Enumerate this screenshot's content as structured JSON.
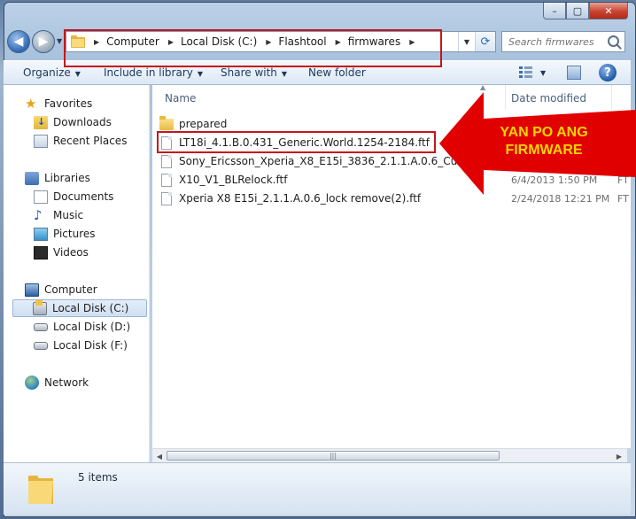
{
  "window": {
    "caption_buttons": [
      "–",
      "▢",
      "✕"
    ]
  },
  "address_bar": {
    "crumbs": [
      "Computer",
      "Local Disk (C:)",
      "Flashtool",
      "firmwares"
    ]
  },
  "search": {
    "placeholder": "Search firmwares"
  },
  "toolbar": {
    "organize": "Organize",
    "include_in_library": "Include in library",
    "share_with": "Share with",
    "new_folder": "New folder"
  },
  "nav_pane": {
    "favorites": {
      "label": "Favorites",
      "items": [
        "Downloads",
        "Recent Places"
      ]
    },
    "libraries": {
      "label": "Libraries",
      "items": [
        "Documents",
        "Music",
        "Pictures",
        "Videos"
      ]
    },
    "computer": {
      "label": "Computer",
      "items": [
        "Local Disk (C:)",
        "Local Disk (D:)",
        "Local Disk (F:)"
      ],
      "selected": "Local Disk (C:)"
    },
    "network": {
      "label": "Network"
    }
  },
  "file_list": {
    "columns": {
      "name": "Name",
      "date_modified": "Date modified"
    },
    "rows": [
      {
        "name": "prepared",
        "date": "",
        "type": "",
        "kind": "folder"
      },
      {
        "name": "LT18i_4.1.B.0.431_Generic.World.1254-2184.ftf",
        "date": "",
        "type": "FT",
        "kind": "file"
      },
      {
        "name": "Sony_Ericsson_Xperia_X8_E15i_3836_2.1.1.A.0.6_Customized_",
        "date": "",
        "type": "FT",
        "kind": "file"
      },
      {
        "name": "X10_V1_BLRelock.ftf",
        "date": "6/4/2013 1:50 PM",
        "type": "FT",
        "kind": "file"
      },
      {
        "name": "Xperia X8  E15i_2.1.1.A.0.6_lock remove(2).ftf",
        "date": "2/24/2018 12:21 PM",
        "type": "FT",
        "kind": "file"
      }
    ]
  },
  "details_pane": {
    "count": "5 items"
  },
  "annotation": {
    "line1": "YAN PO ANG",
    "line2": "FIRMWARE",
    "box_color": "#c4161c",
    "arrow_color": "#e00000",
    "text_color": "#ffd400"
  }
}
